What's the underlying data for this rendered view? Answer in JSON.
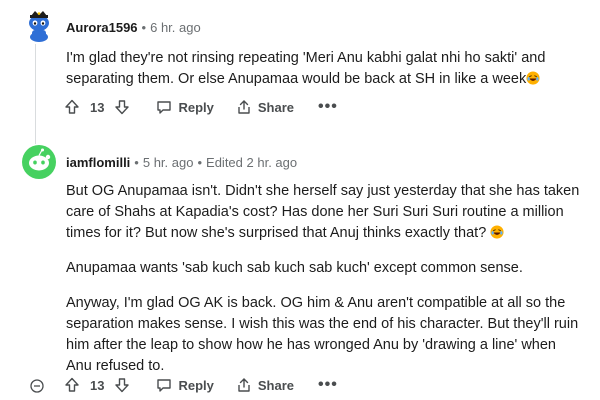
{
  "comments": [
    {
      "username": "Aurora1596",
      "separator": "•",
      "time": "6 hr. ago",
      "edited": "",
      "paragraphs": [
        "I'm glad they're not rinsing repeating 'Meri Anu kabhi galat nhi ho sakti' and separating them. Or else Anupamaa would be back at SH in like a week"
      ],
      "votes": "13",
      "reply_label": "Reply",
      "share_label": "Share",
      "more_label": "•••"
    },
    {
      "username": "iamflomilli",
      "separator": "•",
      "time": "5 hr. ago",
      "edited": "Edited 2 hr. ago",
      "paragraphs": [
        "But OG Anupamaa isn't. Didn't she herself say just yesterday that she has taken care of Shahs at Kapadia's cost? Has done her Suri Suri Suri routine a million times for it? But now she's surprised that Anuj thinks exactly that?",
        "Anupamaa wants 'sab kuch sab kuch sab kuch' except common sense.",
        "Anyway, I'm glad OG AK is back. OG him & Anu aren't compatible at all so the separation makes sense. I wish this was the end of his character. But they'll ruin him after the leap to show how he has wronged Anu by 'drawing a line' when Anu refused to."
      ],
      "votes": "13",
      "reply_label": "Reply",
      "share_label": "Share",
      "more_label": "•••"
    }
  ],
  "icons": {
    "avatar1": "snoo-avatar-icon",
    "avatar2": "default-avatar-icon",
    "emoji": "laughing-emoji-icon",
    "collapse": "collapse-thread-icon"
  },
  "colors": {
    "meta": "#6b6f72",
    "text": "#1c1c1c",
    "avatar_green": "#46d160",
    "emoji": "#ffb000"
  }
}
